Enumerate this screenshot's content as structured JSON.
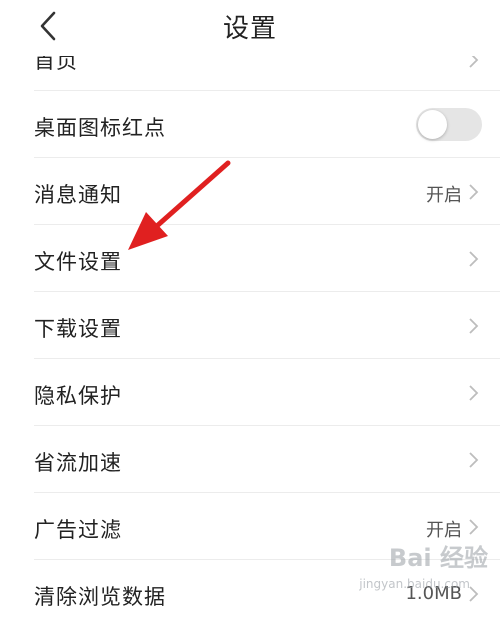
{
  "header": {
    "title": "设置",
    "back_icon": "chevron-left-icon"
  },
  "list": {
    "items": [
      {
        "label": "首页",
        "value": "",
        "control": "chevron"
      },
      {
        "label": "桌面图标红点",
        "value": "",
        "control": "toggle",
        "toggle_on": false
      },
      {
        "label": "消息通知",
        "value": "开启",
        "control": "chevron"
      },
      {
        "label": "文件设置",
        "value": "",
        "control": "chevron"
      },
      {
        "label": "下载设置",
        "value": "",
        "control": "chevron"
      },
      {
        "label": "隐私保护",
        "value": "",
        "control": "chevron"
      },
      {
        "label": "省流加速",
        "value": "",
        "control": "chevron"
      },
      {
        "label": "广告过滤",
        "value": "开启",
        "control": "chevron"
      },
      {
        "label": "清除浏览数据",
        "value": "1.0MB",
        "control": "chevron"
      }
    ]
  },
  "annotation": {
    "type": "red-arrow",
    "color": "#e02020",
    "points_to": "文件设置"
  },
  "watermark": {
    "text": "Bai 经验",
    "sub": "jingyan.baidu.com"
  },
  "colors": {
    "background": "#ffffff",
    "divider": "#ececec",
    "toggle_off": "#e5e5e5",
    "chevron": "#bdbdbd"
  }
}
